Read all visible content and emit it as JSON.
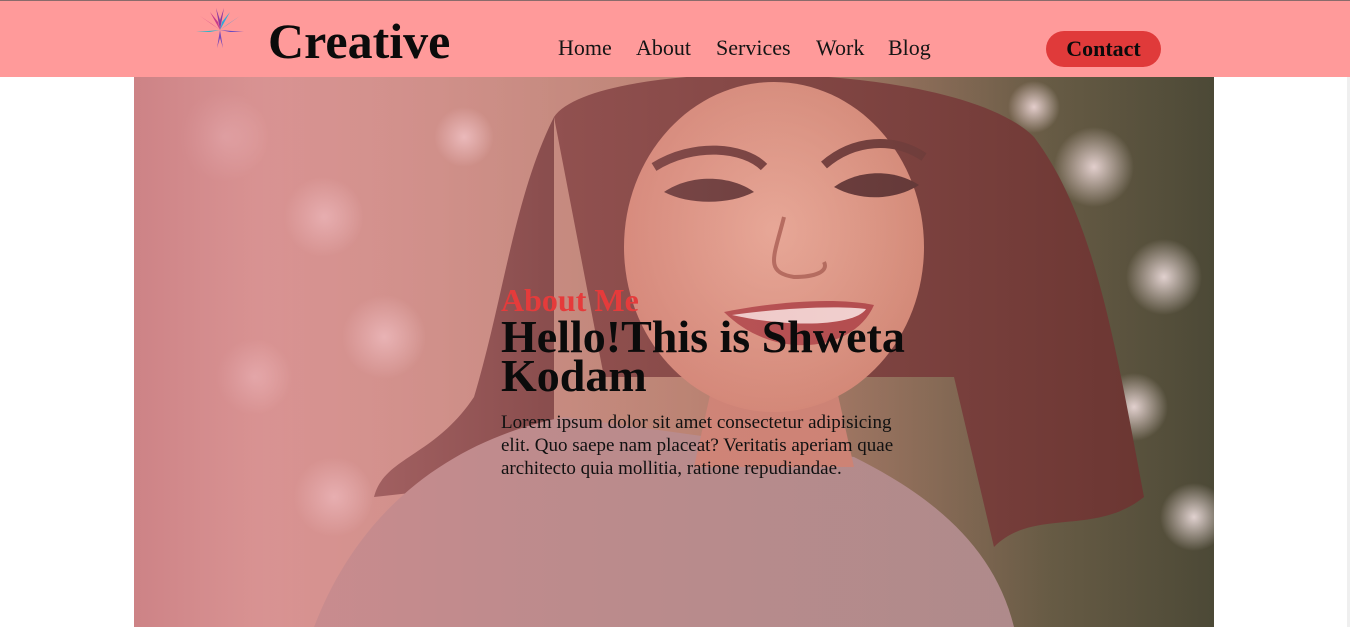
{
  "brand": {
    "name": "Creative",
    "logo_icon": "lotus-icon"
  },
  "nav": {
    "items": [
      {
        "label": "Home"
      },
      {
        "label": "About"
      },
      {
        "label": "Services"
      },
      {
        "label": "Work"
      },
      {
        "label": "Blog"
      }
    ],
    "contact_label": "Contact"
  },
  "hero": {
    "subtitle": "About Me",
    "headline": "Hello!This is Shweta Kodam",
    "paragraph": "Lorem ipsum dolor sit amet consectetur adipisicing elit. Quo saepe nam placeat? Veritatis aperiam quae architecto quia mollitia, ratione repudiandae."
  },
  "colors": {
    "navbar_bg": "#ff9a9a",
    "accent": "#e53b3b",
    "contact_bg": "#e03a3a",
    "text": "#0b0b0b"
  }
}
